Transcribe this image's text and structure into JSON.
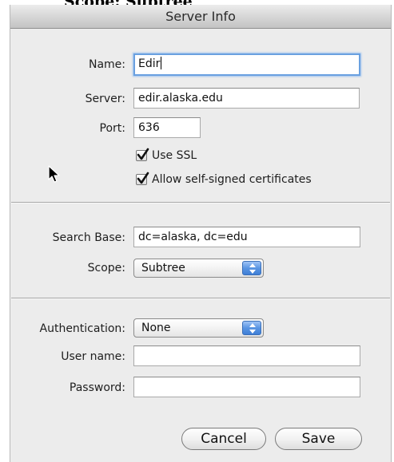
{
  "background_caption": "Scope: Subtree",
  "window": {
    "title": "Server Info"
  },
  "connection": {
    "name_label": "Name:",
    "name_value": "Edir",
    "server_label": "Server:",
    "server_value": "edir.alaska.edu",
    "port_label": "Port:",
    "port_value": "636",
    "use_ssl_label": "Use SSL",
    "use_ssl_checked": true,
    "allow_self_signed_label": "Allow self-signed certificates",
    "allow_self_signed_checked": true
  },
  "search": {
    "search_base_label": "Search Base:",
    "search_base_value": "dc=alaska, dc=edu",
    "scope_label": "Scope:",
    "scope_value": "Subtree"
  },
  "auth": {
    "authentication_label": "Authentication:",
    "authentication_value": "None",
    "user_name_label": "User name:",
    "user_name_value": "",
    "password_label": "Password:",
    "password_value": ""
  },
  "buttons": {
    "cancel_label": "Cancel",
    "save_label": "Save"
  },
  "icons": {
    "check": "checkmark-icon",
    "popup_arrows": "up-down-arrows-icon",
    "cursor": "mouse-pointer-icon"
  },
  "colors": {
    "window_bg": "#ececec",
    "focus_ring": "#6aa0e0",
    "popup_arrow_blue": "#5a95e3"
  }
}
